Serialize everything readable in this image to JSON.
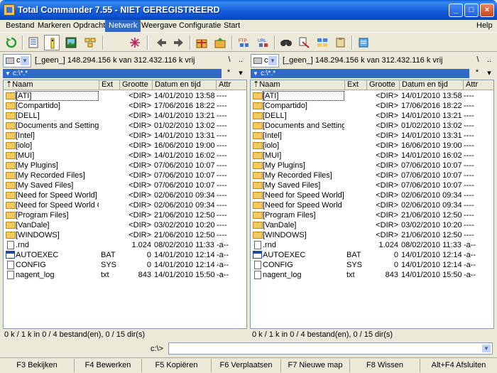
{
  "window": {
    "title": "Total Commander 7.55 - NIET GEREGISTREERD",
    "minimize": "_",
    "maximize": "□",
    "close": "×"
  },
  "menu": [
    "Bestand",
    "Markeren",
    "Opdracht",
    "Netwerk",
    "Weergave",
    "Configuratie",
    "Start"
  ],
  "menu_help": "Help",
  "menu_active": "Netwerk",
  "left": {
    "drive_letter": "c",
    "drive_info": "[_geen_]  148.294.156 k van 312.432.116 k vrij",
    "root_btn": "\\",
    "up_btn": "..",
    "path": "c:\\*.*",
    "filter_btn": "*",
    "menu_btn": "▾",
    "status": "0 k / 1 k in 0 / 4 bestand(en), 0 / 15 dir(s)"
  },
  "right": {
    "drive_letter": "c",
    "drive_info": "[_geen_]  148.294.156 k van 312.432.116 k vrij",
    "root_btn": "\\",
    "up_btn": "..",
    "path": "c:\\*.*",
    "filter_btn": "*",
    "menu_btn": "▾",
    "status": "0 k / 1 k in 0 / 4 bestand(en), 0 / 15 dir(s)"
  },
  "columns": {
    "name": "⇡Naam",
    "ext": "Ext",
    "size": "Grootte",
    "date": "Datum en tijd",
    "attr": "Attr"
  },
  "files": [
    {
      "name": "[ATI]",
      "ext": "",
      "size": "<DIR>",
      "date": "14/01/2010 13:58",
      "attr": "----",
      "type": "folder"
    },
    {
      "name": "[Compartido]",
      "ext": "",
      "size": "<DIR>",
      "date": "17/06/2016 18:22",
      "attr": "----",
      "type": "folder"
    },
    {
      "name": "[DELL]",
      "ext": "",
      "size": "<DIR>",
      "date": "14/01/2010 13:21",
      "attr": "----",
      "type": "folder"
    },
    {
      "name": "[Documents and Settings]",
      "ext": "",
      "size": "<DIR>",
      "date": "01/02/2010 13:02",
      "attr": "----",
      "type": "folder"
    },
    {
      "name": "[Intel]",
      "ext": "",
      "size": "<DIR>",
      "date": "14/01/2010 13:31",
      "attr": "----",
      "type": "folder"
    },
    {
      "name": "[iolo]",
      "ext": "",
      "size": "<DIR>",
      "date": "16/06/2010 19:00",
      "attr": "----",
      "type": "folder"
    },
    {
      "name": "[MUI]",
      "ext": "",
      "size": "<DIR>",
      "date": "14/01/2010 16:02",
      "attr": "----",
      "type": "folder"
    },
    {
      "name": "[My Plugins]",
      "ext": "",
      "size": "<DIR>",
      "date": "07/06/2010 10:07",
      "attr": "----",
      "type": "folder"
    },
    {
      "name": "[My Recorded Files]",
      "ext": "",
      "size": "<DIR>",
      "date": "07/06/2010 10:07",
      "attr": "----",
      "type": "folder"
    },
    {
      "name": "[My Saved Files]",
      "ext": "",
      "size": "<DIR>",
      "date": "07/06/2010 10:07",
      "attr": "----",
      "type": "folder"
    },
    {
      "name": "[Need for Speed World]",
      "ext": "",
      "size": "<DIR>",
      "date": "02/06/2010 09:34",
      "attr": "----",
      "type": "folder"
    },
    {
      "name": "[Need for Speed World Onl..]",
      "ext": "",
      "size": "<DIR>",
      "date": "02/06/2010 09:34",
      "attr": "----",
      "type": "folder"
    },
    {
      "name": "[Program Files]",
      "ext": "",
      "size": "<DIR>",
      "date": "21/06/2010 12:50",
      "attr": "----",
      "type": "folder"
    },
    {
      "name": "[VanDale]",
      "ext": "",
      "size": "<DIR>",
      "date": "03/02/2010 10:20",
      "attr": "----",
      "type": "folder"
    },
    {
      "name": "[WINDOWS]",
      "ext": "",
      "size": "<DIR>",
      "date": "21/06/2010 12:50",
      "attr": "----",
      "type": "folder"
    },
    {
      "name": ".rnd",
      "ext": "",
      "size": "1.024",
      "date": "08/02/2010 11:33",
      "attr": "-a--",
      "type": "file"
    },
    {
      "name": "AUTOEXEC",
      "ext": "BAT",
      "size": "0",
      "date": "14/01/2010 12:14",
      "attr": "-a--",
      "type": "batch"
    },
    {
      "name": "CONFIG",
      "ext": "SYS",
      "size": "0",
      "date": "14/01/2010 12:14",
      "attr": "-a--",
      "type": "file"
    },
    {
      "name": "nagent_log",
      "ext": "txt",
      "size": "843",
      "date": "14/01/2010 15:50",
      "attr": "-a--",
      "type": "file"
    }
  ],
  "cmd": {
    "label": "c:\\>",
    "value": ""
  },
  "fkeys": [
    "F3 Bekijken",
    "F4 Bewerken",
    "F5 Kopiëren",
    "F6 Verplaatsen",
    "F7 Nieuwe map",
    "F8 Wissen",
    "Alt+F4 Afsluiten"
  ],
  "toolbar_icons": [
    "refresh-icon",
    "brief-view-icon",
    "full-view-icon",
    "tree-view-icon",
    "select-icon",
    "back-icon",
    "forward-icon",
    "pack-icon",
    "unpack-icon",
    "ftp-connect-icon",
    "url-connect-icon",
    "find-files-icon",
    "multi-rename-icon",
    "sync-dirs-icon",
    "copy-names-icon",
    "notepad-icon"
  ]
}
